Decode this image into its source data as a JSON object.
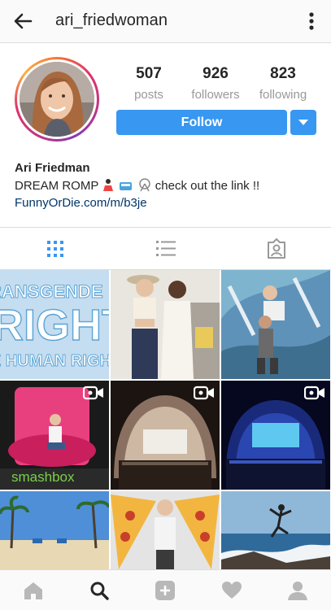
{
  "header": {
    "username": "ari_friedwoman",
    "back_icon": "arrow-left-icon",
    "more_icon": "more-vertical-icon"
  },
  "profile": {
    "stats": [
      {
        "value": "507",
        "label": "posts"
      },
      {
        "value": "926",
        "label": "followers"
      },
      {
        "value": "823",
        "label": "following"
      }
    ],
    "follow_label": "Follow",
    "name": "Ari Friedman",
    "bio_start": "DREAM ROMP",
    "bio_end": "check out the link !!",
    "link": "FunnyOrDie.com/m/b3je"
  },
  "tabs": [
    {
      "icon": "grid-icon",
      "active": true
    },
    {
      "icon": "list-icon",
      "active": false
    },
    {
      "icon": "tagged-icon",
      "active": false
    }
  ],
  "grid": {
    "post1_lines": [
      "RANSGENDE",
      "RIGHTS",
      "E HUMAN RIGH"
    ],
    "post4_caption": "smashbox",
    "video_icon": "video-camera-icon"
  },
  "bottom_nav": [
    "home-icon",
    "search-icon",
    "add-post-icon",
    "heart-icon",
    "profile-icon"
  ],
  "colors": {
    "accent": "#3897f0",
    "link": "#003569",
    "muted": "#999999",
    "border": "#dbdbdb"
  }
}
